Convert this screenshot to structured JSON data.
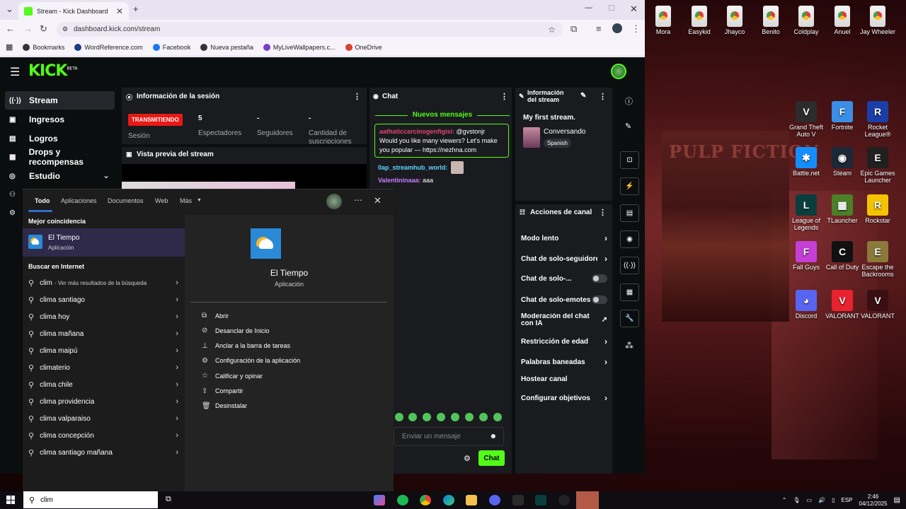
{
  "browser": {
    "tab_title": "Stream - Kick Dashboard",
    "url": "dashboard.kick.com/stream",
    "bookmarks": [
      {
        "label": "Bookmarks",
        "color": "#333333"
      },
      {
        "label": "WordReference.com",
        "color": "#1a3c8a"
      },
      {
        "label": "Facebook",
        "color": "#1877f2"
      },
      {
        "label": "Nueva pestaña",
        "color": "#333333"
      },
      {
        "label": "MyLiveWallpapers.c...",
        "color": "#7b3ec7"
      },
      {
        "label": "OneDrive",
        "color": "#d9412b"
      }
    ]
  },
  "kick": {
    "logo": "KICK",
    "logo_tag": "BETA",
    "sidebar": [
      {
        "label": "Stream",
        "icon": "((·))"
      },
      {
        "label": "Ingresos",
        "icon": "▣"
      },
      {
        "label": "Logros",
        "icon": "▤"
      },
      {
        "label": "Drops y recompensas",
        "icon": "▦"
      },
      {
        "label": "Estudio",
        "icon": "◎"
      }
    ],
    "session": {
      "title": "Información de la sesión",
      "live_badge": "TRANSMITIENDO",
      "session_label": "Sesión",
      "viewers_value": "5",
      "viewers_label": "Espectadores",
      "followers_value": "-",
      "followers_label": "Seguidores",
      "subs_value": "-",
      "subs_label": "Cantidad de suscripciones"
    },
    "preview_title": "Vista previa del stream",
    "chat": {
      "title": "Chat",
      "new_messages": "Nuevos mensajes",
      "highlight_user": "aathaticcarcinogenfigisi:",
      "highlight_mention": "@gvstonjr",
      "highlight_text": "Would you like many viewers? Let's make you popular — https://nezhna.com",
      "msg2_user": "0ap_streamhub_world:",
      "msg3_user": "Valentininaaa:",
      "msg3_text": "aaa",
      "input_placeholder": "Enviar un mensaje",
      "send_label": "Chat"
    },
    "stream_info": {
      "title": "Información del stream",
      "stream_title": "My first stream.",
      "category": "Conversando",
      "language": "Spanish"
    },
    "channel_actions": {
      "title": "Acciones de canal",
      "items": [
        {
          "label": "Modo lento",
          "kind": "chevron"
        },
        {
          "label": "Chat de solo-seguidores",
          "kind": "chevron"
        },
        {
          "label": "Chat de solo-...",
          "kind": "toggle"
        },
        {
          "label": "Chat de solo-emotes",
          "kind": "toggle"
        },
        {
          "label": "Moderación del chat con IA",
          "kind": "external"
        },
        {
          "label": "Restricción de edad",
          "kind": "chevron"
        },
        {
          "label": "Palabras baneadas",
          "kind": "chevron"
        },
        {
          "label": "Hostear canal",
          "kind": "none"
        },
        {
          "label": "Configurar objetivos",
          "kind": "chevron"
        }
      ]
    }
  },
  "search_panel": {
    "tabs": [
      "Todo",
      "Aplicaciones",
      "Documentos",
      "Web",
      "Más"
    ],
    "best_match_heading": "Mejor coincidencia",
    "best_match_name": "El Tiempo",
    "best_match_type": "Aplicación",
    "internet_heading": "Buscar en Internet",
    "first_result_term": "clim",
    "first_result_hint": "- Ver más resultados de la búsqueda",
    "results": [
      "clima santiago",
      "clima hoy",
      "clima mañana",
      "clima maipú",
      "climaterio",
      "clima chile",
      "clima providencia",
      "clima valparaiso",
      "clima concepción",
      "clima santiago mañana"
    ],
    "detail_name": "El Tiempo",
    "detail_type": "Aplicación",
    "actions": [
      {
        "label": "Abrir",
        "icon": "⧉"
      },
      {
        "label": "Desanclar de Inicio",
        "icon": "⊘"
      },
      {
        "label": "Anclar a la barra de tareas",
        "icon": "⊥"
      },
      {
        "label": "Configuración de la aplicación",
        "icon": "⚙"
      },
      {
        "label": "Calificar y opinar",
        "icon": "☆"
      },
      {
        "label": "Compartir",
        "icon": "⇪"
      },
      {
        "label": "Desinstalar",
        "icon": "🗑"
      }
    ]
  },
  "desktop_icons": [
    {
      "label": "Mora",
      "kind": "file"
    },
    {
      "label": "Easykid",
      "kind": "file"
    },
    {
      "label": "Jhayco",
      "kind": "file"
    },
    {
      "label": "Benito",
      "kind": "file"
    },
    {
      "label": "Coldplay",
      "kind": "file"
    },
    {
      "label": "Anuel",
      "kind": "file"
    },
    {
      "label": "Jay Wheeler",
      "kind": "file"
    },
    {
      "label": "Grand Theft Auto V",
      "color": "#2c2c2c",
      "glyph": "V"
    },
    {
      "label": "Fortnite",
      "color": "#3a8ee6",
      "glyph": "F"
    },
    {
      "label": "Rocket League®",
      "color": "#1a3fa8",
      "glyph": "R"
    },
    {
      "label": "Battle.net",
      "color": "#148eff",
      "glyph": "✱"
    },
    {
      "label": "Steam",
      "color": "#1b2838",
      "glyph": "◉"
    },
    {
      "label": "Epic Games Launcher",
      "color": "#202020",
      "glyph": "E"
    },
    {
      "label": "League of Legends",
      "color": "#0a3d3d",
      "glyph": "L"
    },
    {
      "label": "TLauncher",
      "color": "#4b7f2a",
      "glyph": "▦"
    },
    {
      "label": "Rockstar",
      "color": "#f5c400",
      "glyph": "R"
    },
    {
      "label": "Fall Guys",
      "color": "#c43fd6",
      "glyph": "F"
    },
    {
      "label": "Call of Duty",
      "color": "#111111",
      "glyph": "C"
    },
    {
      "label": "Escape the Backrooms",
      "color": "#8a7a3a",
      "glyph": "E"
    },
    {
      "label": "Discord",
      "color": "#5865f2",
      "glyph": "◕"
    },
    {
      "label": "VALORANT",
      "color": "#e8222e",
      "glyph": "V"
    },
    {
      "label": "VALORANT",
      "color": "#3a0f14",
      "glyph": "V"
    }
  ],
  "taskbar": {
    "search_text": "clim",
    "language": "ESP",
    "time": "2:46",
    "date": "04/12/2025"
  },
  "wallpaper_text": "PULP FICTION",
  "colors": {
    "kick_green": "#53fc18",
    "live_red": "#e91916",
    "search_highlight": "#2f2a4a"
  }
}
